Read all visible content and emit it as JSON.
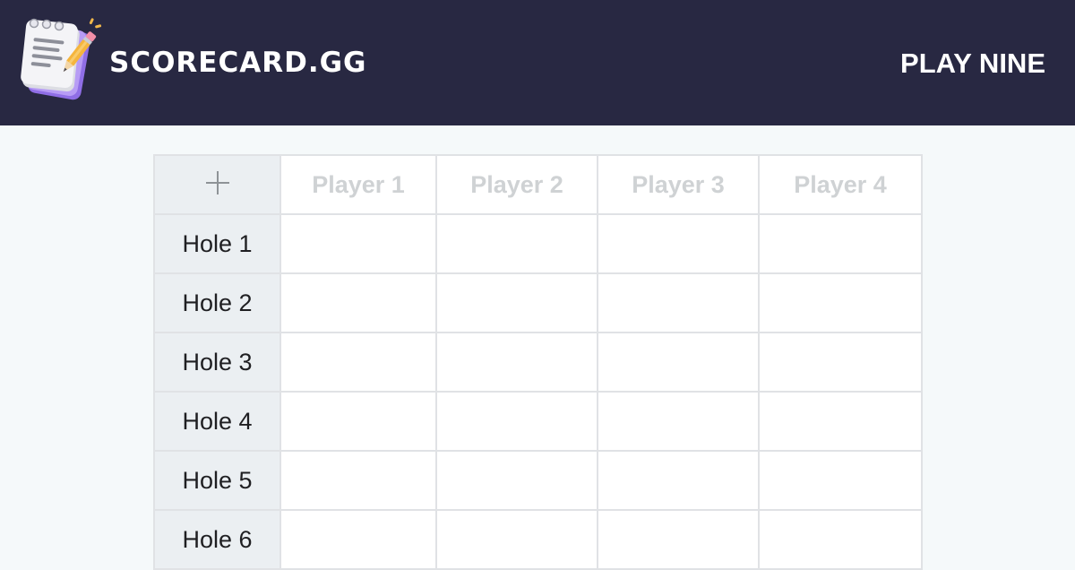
{
  "header": {
    "brand": "scorecard.gg",
    "game_title": "PLAY NINE",
    "logo_icon": "notepad-pencil-icon"
  },
  "table": {
    "add_player_icon": "plus-icon",
    "players": [
      "Player 1",
      "Player 2",
      "Player 3",
      "Player 4"
    ],
    "holes": [
      "Hole 1",
      "Hole 2",
      "Hole 3",
      "Hole 4",
      "Hole 5",
      "Hole 6"
    ]
  },
  "colors": {
    "header_bg": "#282842",
    "page_bg": "#f5f9fa",
    "row_header_bg": "#ebeff2",
    "grid_border": "#e0e2e5",
    "player_placeholder": "#cfd2d4"
  }
}
